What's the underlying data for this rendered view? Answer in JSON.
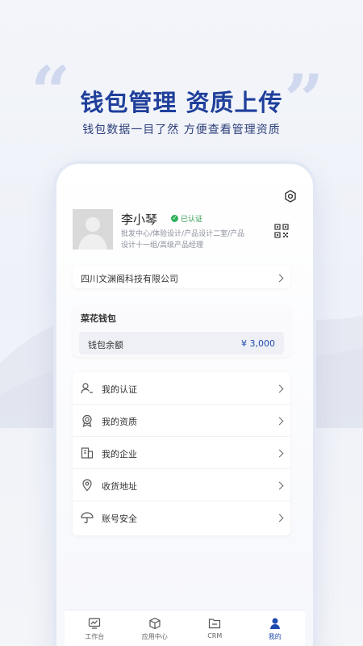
{
  "banner": {
    "headline": "钱包管理 资质上传",
    "subline": "钱包数据一目了然 方便查看管理资质"
  },
  "profile": {
    "name": "李小琴",
    "badge": "已认证",
    "departments": "批发中心/体验设计/产品设计二室/产品设计十一组/高级产品经理"
  },
  "company": {
    "name": "四川文渊阁科技有限公司"
  },
  "wallet": {
    "title": "菜花钱包",
    "balance_label": "钱包余额",
    "balance_value": "¥ 3,000"
  },
  "menu": [
    {
      "label": "我的认证",
      "icon": "user-verify-icon"
    },
    {
      "label": "我的资质",
      "icon": "award-icon"
    },
    {
      "label": "我的企业",
      "icon": "building-icon"
    },
    {
      "label": "收货地址",
      "icon": "location-icon"
    },
    {
      "label": "账号安全",
      "icon": "umbrella-icon"
    }
  ],
  "tabs": [
    {
      "label": "工作台",
      "icon": "monitor-icon",
      "active": false
    },
    {
      "label": "应用中心",
      "icon": "cube-icon",
      "active": false
    },
    {
      "label": "CRM",
      "icon": "folder-icon",
      "active": false
    },
    {
      "label": "我的",
      "icon": "person-icon",
      "active": true
    }
  ],
  "colors": {
    "primary": "#1f4bb0",
    "headline": "#1f3f9b",
    "verified": "#2fb25a"
  }
}
